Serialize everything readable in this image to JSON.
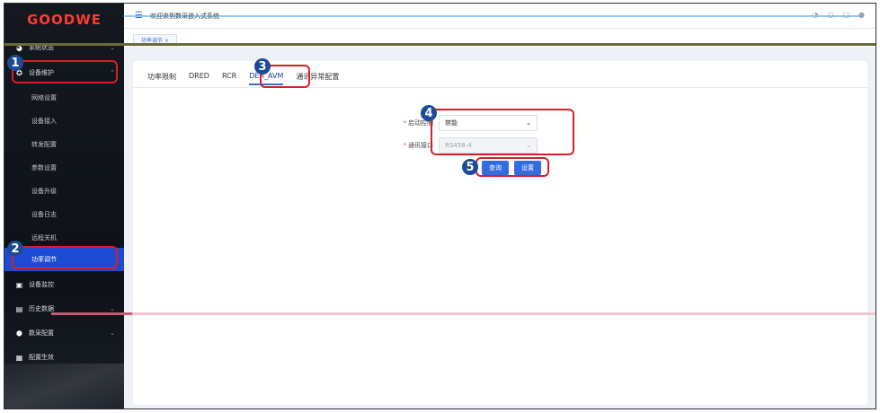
{
  "app": {
    "logo": "GOODWE",
    "welcome": "欢迎来到数采嵌入式系统"
  },
  "sidebar": {
    "groups": [
      {
        "label": "系统状态",
        "icon": "pie-icon"
      },
      {
        "label": "设备维护",
        "icon": "wrench-icon"
      }
    ],
    "sub_items": [
      "网络设置",
      "设备接入",
      "转发配置",
      "参数设置",
      "设备升级",
      "设备日志",
      "远程关机",
      "功率调节"
    ],
    "bottom_items": [
      {
        "label": "设备监控",
        "icon": "monitor-icon"
      },
      {
        "label": "历史数据",
        "icon": "history-icon"
      },
      {
        "label": "数采配置",
        "icon": "config-icon"
      },
      {
        "label": "配置生效",
        "icon": "apply-icon"
      }
    ]
  },
  "page_tab": "功率调节",
  "tabs": [
    "功率限制",
    "DRED",
    "RCR",
    "DER_AVM",
    "通讯异常配置"
  ],
  "active_tab": "DER_AVM",
  "form": {
    "enable_label": "启动控制",
    "enable_value": "禁能",
    "port_label": "通讯接口",
    "port_value": "RS458-4"
  },
  "buttons": {
    "query": "查询",
    "set": "设置"
  },
  "callouts": [
    "1",
    "2",
    "3",
    "4",
    "5"
  ]
}
